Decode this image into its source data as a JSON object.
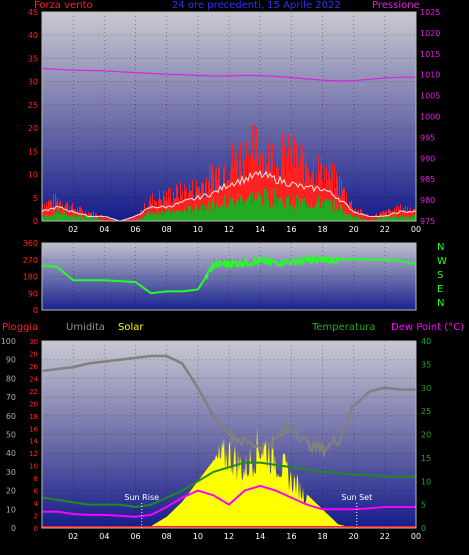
{
  "colors": {
    "background": "#000000",
    "wind": "#ff2020",
    "gust_line": "#f0f0f0",
    "wind_avg": "#22aa22",
    "pressure": "#e020e0",
    "direction": "#22ff22",
    "rain": "#ff2020",
    "humidity": "#808080",
    "solar": "#ffff00",
    "temperature": "#228822",
    "dewpoint": "#ff00ff"
  },
  "titles": {
    "wind": "Forza vento",
    "center": "24 ore precedenti, 15 Aprile 2022",
    "pressure": "Pressione",
    "rain": "Pioggia",
    "humidity": "Umidita",
    "solar": "Solar",
    "temperature": "Temperatura",
    "dewpoint": "Dew Point (°C)"
  },
  "annotations": {
    "sunrise": "Sun Rise",
    "sunset": "Sun Set"
  },
  "compass": [
    "N",
    "W",
    "S",
    "E",
    "N"
  ],
  "chart_data": [
    {
      "type": "line",
      "title": "Forza vento",
      "x_hours": [
        0,
        1,
        2,
        3,
        4,
        5,
        6,
        7,
        8,
        9,
        10,
        11,
        12,
        13,
        14,
        15,
        16,
        17,
        18,
        19,
        20,
        21,
        22,
        23,
        24
      ],
      "x_tick_labels": [
        "02",
        "04",
        "06",
        "08",
        "10",
        "12",
        "14",
        "16",
        "18",
        "20",
        "22",
        "00"
      ],
      "ylim_left": [
        0,
        45
      ],
      "y_ticks_left": [
        "0",
        "5",
        "10",
        "15",
        "20",
        "25",
        "30",
        "35",
        "40",
        "45"
      ],
      "ylim_right": [
        975,
        1025
      ],
      "y_ticks_right": [
        "975",
        "980",
        "985",
        "990",
        "995",
        "1000",
        "1005",
        "1010",
        "1015",
        "1020",
        "1025"
      ],
      "series": [
        {
          "name": "Forza vento",
          "axis": "left",
          "values": [
            4,
            5,
            3,
            2,
            1,
            0,
            1,
            5,
            6,
            7,
            8,
            11,
            14,
            16,
            18,
            16,
            15,
            14,
            12,
            9,
            3,
            1,
            2,
            3,
            3
          ]
        },
        {
          "axis": "left",
          "values": [
            2,
            3,
            2,
            1,
            1,
            0,
            1,
            3,
            3,
            4,
            5,
            6,
            8,
            9,
            10,
            9,
            8,
            7,
            7,
            5,
            2,
            1,
            1,
            2,
            2
          ]
        },
        {
          "axis": "left",
          "values": [
            1,
            2,
            1,
            1,
            0,
            0,
            0,
            2,
            2,
            2,
            3,
            4,
            4,
            5,
            5,
            5,
            4,
            4,
            4,
            3,
            1,
            0,
            1,
            1,
            1
          ]
        },
        {
          "name": "Pressione",
          "axis": "right",
          "values": [
            1011.5,
            1011.3,
            1011.1,
            1011.0,
            1010.9,
            1010.7,
            1010.5,
            1010.3,
            1010.1,
            1010.0,
            1009.8,
            1009.7,
            1009.7,
            1009.8,
            1009.8,
            1009.6,
            1009.3,
            1009.0,
            1008.7,
            1008.5,
            1008.6,
            1008.9,
            1009.2,
            1009.4,
            1009.4
          ]
        }
      ]
    },
    {
      "type": "line",
      "series_label": "direction",
      "x_hours": [
        0,
        1,
        2,
        3,
        4,
        5,
        6,
        7,
        8,
        9,
        10,
        11,
        12,
        13,
        14,
        15,
        16,
        17,
        18,
        19,
        20,
        21,
        22,
        23,
        24
      ],
      "ylim": [
        0,
        360
      ],
      "y_ticks": [
        "0",
        "90",
        "180",
        "270",
        "360"
      ],
      "values": [
        240,
        230,
        160,
        160,
        160,
        155,
        150,
        90,
        100,
        100,
        110,
        240,
        250,
        255,
        260,
        255,
        260,
        265,
        270,
        270,
        275,
        270,
        270,
        265,
        245
      ]
    },
    {
      "type": "line",
      "x_hours": [
        0,
        1,
        2,
        3,
        4,
        5,
        6,
        7,
        8,
        9,
        10,
        11,
        12,
        13,
        14,
        15,
        16,
        17,
        18,
        19,
        20,
        21,
        22,
        23,
        24
      ],
      "y_left_outer": {
        "ylim": [
          0,
          100
        ],
        "ticks": [
          "0",
          "10",
          "20",
          "30",
          "40",
          "50",
          "60",
          "70",
          "80",
          "90",
          "100"
        ]
      },
      "y_left_inner": {
        "ylim": [
          0,
          30
        ],
        "ticks": [
          "0",
          "2",
          "4",
          "6",
          "8",
          "10",
          "12",
          "14",
          "16",
          "18",
          "20",
          "22",
          "24",
          "26",
          "28",
          "30"
        ]
      },
      "y_right": {
        "ylim": [
          0,
          40
        ],
        "ticks": [
          "0",
          "5",
          "10",
          "15",
          "20",
          "25",
          "30",
          "35",
          "40"
        ]
      },
      "series": [
        {
          "name": "Umidita",
          "axis": "outer",
          "values": [
            84,
            85,
            86,
            88,
            89,
            90,
            91,
            92,
            92,
            88,
            75,
            60,
            50,
            46,
            44,
            47,
            55,
            45,
            42,
            47,
            65,
            73,
            75,
            74,
            74
          ]
        },
        {
          "name": "Solar",
          "axis": "outer",
          "fill": true,
          "values": [
            0,
            0,
            0,
            0,
            0,
            0,
            0,
            1,
            6,
            14,
            25,
            36,
            43,
            33,
            48,
            40,
            28,
            18,
            10,
            2,
            0,
            0,
            0,
            0,
            0
          ]
        },
        {
          "name": "Temperatura",
          "axis": "right",
          "values": [
            6.5,
            6,
            5.5,
            5,
            5,
            5,
            4.5,
            5,
            6.5,
            8,
            10,
            12,
            13,
            14,
            14,
            13.5,
            13,
            12.5,
            12,
            11.8,
            11.5,
            11.3,
            11,
            11,
            11
          ]
        },
        {
          "name": "Dew Point (°C)",
          "axis": "right",
          "values": [
            3.5,
            3.5,
            3,
            2.8,
            2.8,
            2.6,
            2.4,
            2.8,
            4.5,
            6.5,
            8,
            7,
            5,
            8,
            9,
            8,
            6.5,
            5,
            4,
            4,
            4,
            4.2,
            4.5,
            4.5,
            4.5
          ]
        },
        {
          "name": "Pioggia",
          "axis": "inner",
          "values": [
            0,
            0,
            0,
            0,
            0,
            0,
            0,
            0,
            0,
            0,
            0,
            0,
            0,
            0,
            0,
            0,
            0,
            0,
            0,
            0,
            0,
            0,
            0,
            0,
            0
          ]
        }
      ],
      "x_tick_labels": [
        "02",
        "04",
        "06",
        "08",
        "10",
        "12",
        "14",
        "16",
        "18",
        "20",
        "22",
        "00"
      ]
    }
  ]
}
